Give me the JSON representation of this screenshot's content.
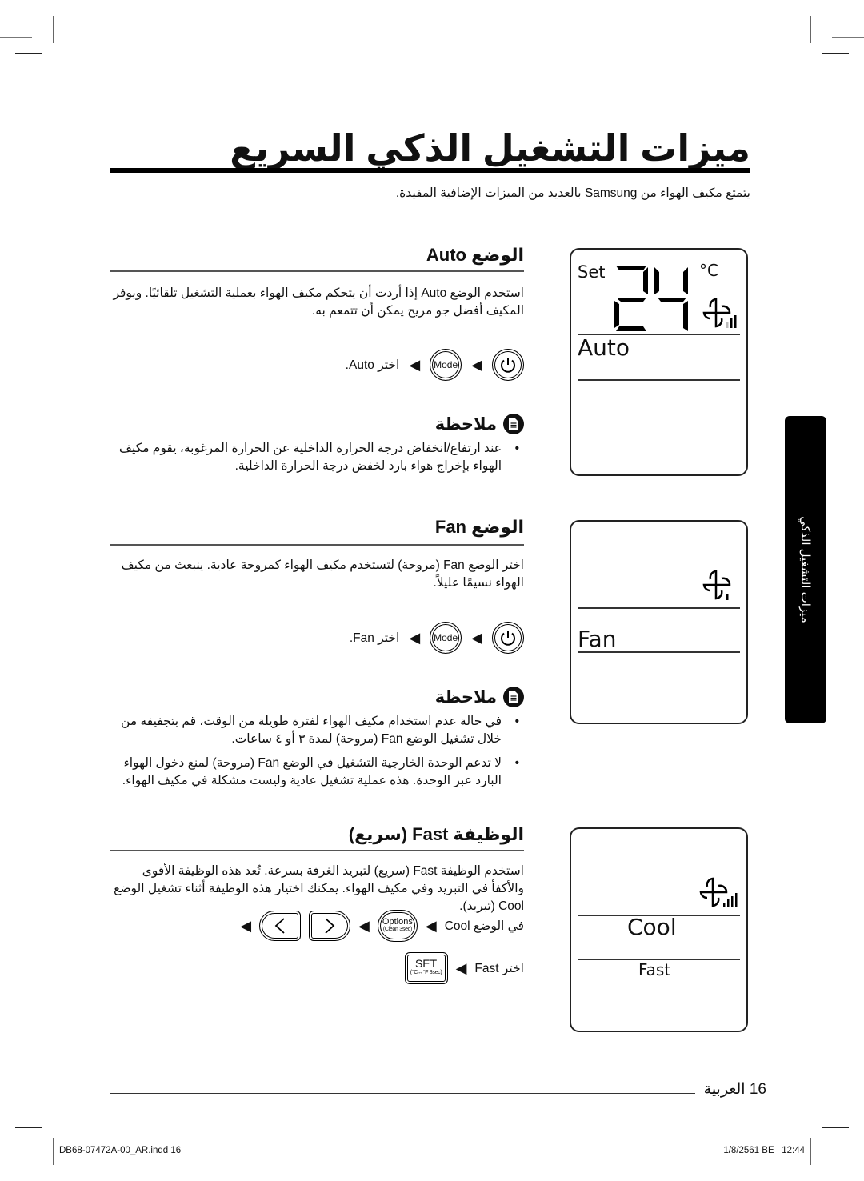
{
  "page": {
    "title": "ميزات التشغيل الذكي السريع",
    "intro": "يتمتع مكيف الهواء من Samsung بالعديد من الميزات الإضافية المفيدة.",
    "side_tab": "ميزات التشغيل الذكي",
    "page_number": "16",
    "page_language": "العربية",
    "footer_file": "DB68-07472A-00_AR.indd   16",
    "footer_date": "1/8/2561 BE   12:44"
  },
  "auto": {
    "title": "الوضع Auto",
    "text": "استخدم الوضع Auto إذا أردت أن يتحكم مكيف الهواء بعملية التشغيل تلقائيًا. ويوفر المكيف أفضل جو مريح يمكن أن تتمعم به.",
    "step_text": "اختر Auto.",
    "mode_label": "Mode",
    "note_title": "ملاحظة",
    "notes": [
      "عند ارتفاع/انخفاض درجة الحرارة الداخلية عن الحرارة المرغوبة، يقوم مكيف الهواء بإخراج هواء بارد لخفض درجة الحرارة الداخلية."
    ],
    "lcd": {
      "set_label": "Set",
      "temperature": "24",
      "unit": "°C",
      "mode": "Auto",
      "fan_level": 2,
      "fan_max": 3
    }
  },
  "fan": {
    "title": "الوضع Fan",
    "text": "اختر الوضع Fan (مروحة) لتستخدم مكيف الهواء كمروحة عادية. ينبعث من مكيف الهواء نسيمًا عليلاً.",
    "step_text": "اختر Fan.",
    "mode_label": "Mode",
    "note_title": "ملاحظة",
    "notes": [
      "في حالة عدم استخدام مكيف الهواء لفترة طويلة من الوقت، قم بتجفيفه من خلال تشغيل الوضع Fan (مروحة) لمدة ٣ أو ٤ ساعات.",
      "لا تدعم الوحدة الخارجية التشغيل في الوضع Fan (مروحة) لمنع دخول الهواء البارد عبر الوحدة. هذه عملية تشغيل عادية وليست مشكلة في مكيف الهواء."
    ],
    "lcd": {
      "mode": "Fan",
      "fan_level": 1,
      "fan_max": 1
    }
  },
  "fast": {
    "title": "الوظيفة Fast (سريع)",
    "text": "استخدم الوظيفة Fast (سريع) لتبريد الغرفة بسرعة. تُعد هذه الوظيفة الأقوى والأكفأ في التبريد وفي مكيف الهواء. يمكنك اختيار هذه الوظيفة أثناء تشغيل الوضع Cool (تبريد).",
    "step1_text": "في الوضع Cool",
    "options_label": "Options",
    "options_sub": "(Clean 3sec)",
    "left_label": "<",
    "right_label": ">",
    "step2_text": "اختر Fast",
    "set_label": "SET",
    "set_sub": "(°C↔°F 3sec)",
    "lcd": {
      "mode": "Cool",
      "function": "Fast",
      "fan_level": 4,
      "fan_max": 4
    }
  },
  "icons": {
    "arrow": "◀"
  }
}
